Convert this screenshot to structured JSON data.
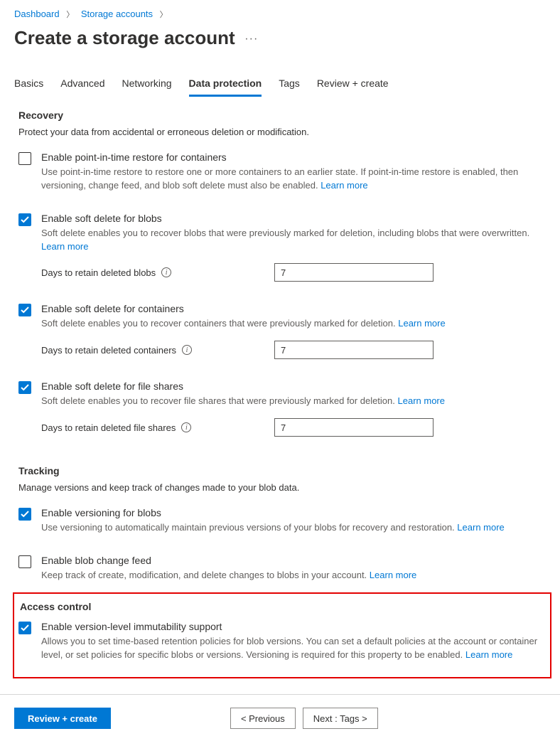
{
  "breadcrumb": {
    "dashboard": "Dashboard",
    "storage": "Storage accounts"
  },
  "page_title": "Create a storage account",
  "tabs": {
    "basics": "Basics",
    "advanced": "Advanced",
    "networking": "Networking",
    "data_protection": "Data protection",
    "tags": "Tags",
    "review": "Review + create"
  },
  "recovery": {
    "title": "Recovery",
    "desc": "Protect your data from accidental or erroneous deletion or modification.",
    "pitr": {
      "label": "Enable point-in-time restore for containers",
      "desc": "Use point-in-time restore to restore one or more containers to an earlier state. If point-in-time restore is enabled, then versioning, change feed, and blob soft delete must also be enabled.",
      "learn": "Learn more"
    },
    "soft_blobs": {
      "label": "Enable soft delete for blobs",
      "desc": "Soft delete enables you to recover blobs that were previously marked for deletion, including blobs that were overwritten.",
      "learn": "Learn more",
      "retain_label": "Days to retain deleted blobs",
      "retain_value": "7"
    },
    "soft_containers": {
      "label": "Enable soft delete for containers",
      "desc": "Soft delete enables you to recover containers that were previously marked for deletion.",
      "learn": "Learn more",
      "retain_label": "Days to retain deleted containers",
      "retain_value": "7"
    },
    "soft_shares": {
      "label": "Enable soft delete for file shares",
      "desc": "Soft delete enables you to recover file shares that were previously marked for deletion.",
      "learn": "Learn more",
      "retain_label": "Days to retain deleted file shares",
      "retain_value": "7"
    }
  },
  "tracking": {
    "title": "Tracking",
    "desc": "Manage versions and keep track of changes made to your blob data.",
    "versioning": {
      "label": "Enable versioning for blobs",
      "desc": "Use versioning to automatically maintain previous versions of your blobs for recovery and restoration.",
      "learn": "Learn more"
    },
    "change_feed": {
      "label": "Enable blob change feed",
      "desc": "Keep track of create, modification, and delete changes to blobs in your account.",
      "learn": "Learn more"
    }
  },
  "access": {
    "title": "Access control",
    "immutability": {
      "label": "Enable version-level immutability support",
      "desc": "Allows you to set time-based retention policies for blob versions. You can set a default policies at the account or container level, or set policies for specific blobs or versions. Versioning is required for this property to be enabled.",
      "learn": "Learn more"
    }
  },
  "footer": {
    "review": "Review + create",
    "prev": "< Previous",
    "next": "Next : Tags >"
  }
}
